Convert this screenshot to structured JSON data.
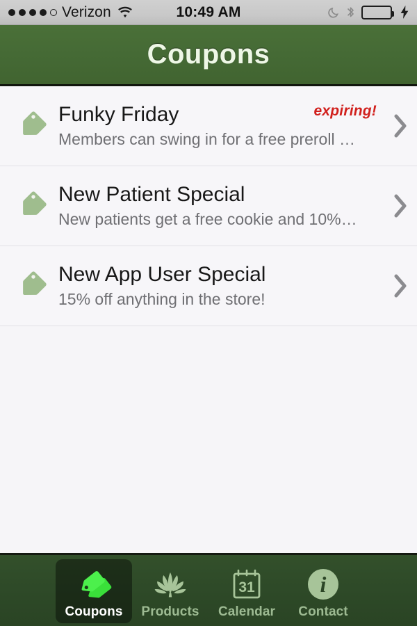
{
  "status_bar": {
    "carrier": "Verizon",
    "signal_dots_filled": 4,
    "signal_dots_total": 5,
    "wifi_icon": "wifi-icon",
    "time": "10:49 AM",
    "moon_icon": "moon-do-not-disturb-icon",
    "bluetooth_icon": "bluetooth-icon",
    "battery_icon": "battery-full-icon",
    "battery_charging_icon": "lightning-bolt-icon",
    "battery_color": "#4cd755"
  },
  "header": {
    "title": "Coupons",
    "background_color": "#456a35",
    "title_color": "#eef7e6"
  },
  "list": {
    "items": [
      {
        "icon": "tag-icon",
        "title": "Funky Friday",
        "subtitle": "Members can swing in for a free preroll …",
        "badge": "expiring!",
        "badge_color": "#d1201d",
        "chevron": "chevron-right-icon"
      },
      {
        "icon": "tag-icon",
        "title": "New Patient Special",
        "subtitle": "New patients get a free cookie and 10%…",
        "badge": "",
        "badge_color": "#d1201d",
        "chevron": "chevron-right-icon"
      },
      {
        "icon": "tag-icon",
        "title": "New App User Special",
        "subtitle": "15% off anything in the store!",
        "badge": "",
        "badge_color": "#d1201d",
        "chevron": "chevron-right-icon"
      }
    ]
  },
  "tab_bar": {
    "background_color": "#2e4a28",
    "active_index": 0,
    "tabs": [
      {
        "label": "Coupons",
        "icon": "tag-icon",
        "active": true
      },
      {
        "label": "Products",
        "icon": "leaf-icon",
        "active": false
      },
      {
        "label": "Calendar",
        "icon": "calendar-icon",
        "active": false,
        "calendar_day": "31"
      },
      {
        "label": "Contact",
        "icon": "info-icon",
        "active": false
      }
    ]
  }
}
